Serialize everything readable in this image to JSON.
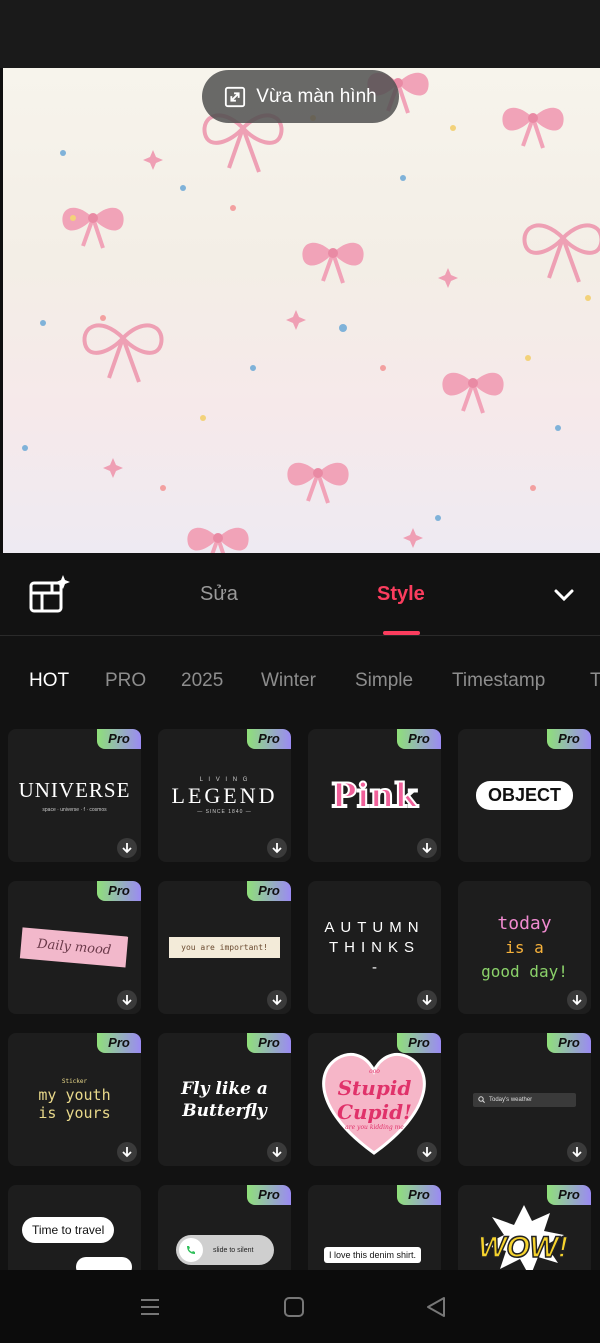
{
  "canvas": {
    "fit_button_label": "Vừa màn hình"
  },
  "tabs": {
    "edit_label": "Sửa",
    "style_label": "Style",
    "active": "Style"
  },
  "categories": [
    "HOT",
    "PRO",
    "2025",
    "Winter",
    "Simple",
    "Timestamp",
    "T"
  ],
  "tiles": [
    {
      "id": "universe",
      "pro": true,
      "text": "UNIVERSE",
      "sub": "space · universe · f · cosmos"
    },
    {
      "id": "legend",
      "pro": true,
      "text": "LEGEND",
      "top": "L I V I N G",
      "sub": "— SINCE 1840 —"
    },
    {
      "id": "pink",
      "pro": true,
      "text": "Pink"
    },
    {
      "id": "object",
      "pro": true,
      "text": "OBJECT"
    },
    {
      "id": "daily-mood",
      "pro": true,
      "text": "Daily mood"
    },
    {
      "id": "you-are-important",
      "pro": true,
      "text": "you are important!"
    },
    {
      "id": "autumn-thinks",
      "pro": false,
      "text": "AUTUMN",
      "text2": "THINKS",
      "text3": "-"
    },
    {
      "id": "today-good-day",
      "pro": false,
      "text": "today",
      "text2": "is a",
      "text3": "good day!"
    },
    {
      "id": "my-youth",
      "pro": true,
      "top": "Sticker",
      "text": "my youth",
      "text2": "is yours"
    },
    {
      "id": "fly-butterfly",
      "pro": true,
      "text": "Fly like a",
      "text2": "Butterfly"
    },
    {
      "id": "stupid-cupid",
      "pro": true,
      "top": "ooo",
      "text": "Stupid",
      "text2": "Cupid!",
      "sub": "are you kidding me"
    },
    {
      "id": "todays-weather",
      "pro": true,
      "text": "Today's weather"
    },
    {
      "id": "time-to-travel",
      "pro": false,
      "text": "Time to travel"
    },
    {
      "id": "slide-to-silent",
      "pro": true,
      "text": "slide to silent"
    },
    {
      "id": "denim-shirt",
      "pro": true,
      "text": "I love this denim shirt."
    },
    {
      "id": "wow",
      "pro": true,
      "text": "WOW!"
    }
  ],
  "pro_badge": "Pro",
  "colors": {
    "accent": "#fb3d5e",
    "panel": "#121212",
    "tile": "#1d1d1d"
  }
}
